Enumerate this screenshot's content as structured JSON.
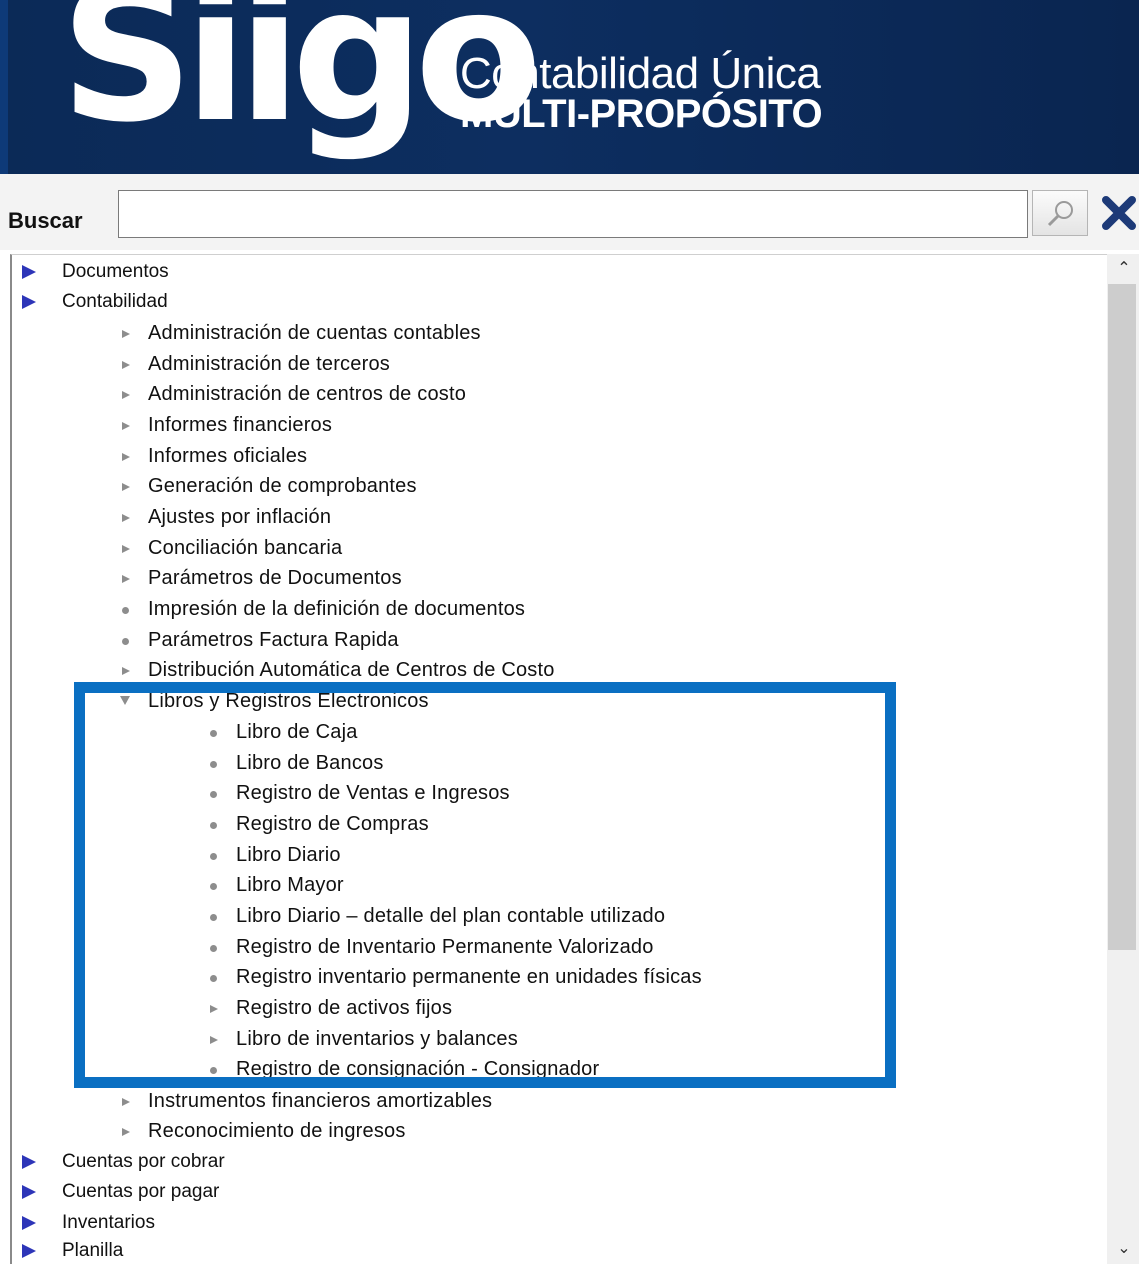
{
  "header": {
    "logo_text": "Siigo",
    "subtitle_line1": "Contabilidad Única",
    "subtitle_line2": "MULTI-PROPÓSITO"
  },
  "search": {
    "label": "Buscar",
    "value": "",
    "placeholder": ""
  },
  "tree": {
    "top_1": "Documentos",
    "top_2": "Contabilidad",
    "sub": [
      "Administración de cuentas contables",
      "Administración de terceros",
      "Administración de centros de costo",
      "Informes financieros",
      "Informes oficiales",
      "Generación de comprobantes",
      "Ajustes por inflación",
      "Conciliación bancaria",
      "Parámetros de Documentos",
      "Impresión de la definición de documentos",
      "Parámetros Factura Rapida",
      "Distribución Automática de Centros de Costo",
      "Libros y Registros Electronicos"
    ],
    "libros": [
      "Libro de Caja",
      "Libro de Bancos",
      "Registro de Ventas e Ingresos",
      "Registro de Compras",
      "Libro Diario",
      "Libro Mayor",
      "Libro Diario – detalle del plan contable utilizado",
      "Registro de Inventario Permanente Valorizado",
      "Registro inventario permanente en unidades físicas",
      "Registro de activos fijos",
      "Libro de inventarios y balances",
      "Registro de consignación - Consignador"
    ],
    "sub_after": [
      "Instrumentos financieros amortizables",
      "Reconocimiento de ingresos"
    ],
    "top_after": [
      "Cuentas por cobrar",
      "Cuentas por pagar",
      "Inventarios",
      "Planilla"
    ]
  },
  "colors": {
    "banner": "#0b2a57",
    "top_arrow": "#2d35b8",
    "highlight": "#0a6fc2"
  },
  "icons": {
    "search": "magnifier-icon",
    "clear": "close-x-icon",
    "expand": "triangle-right-icon",
    "expanded": "triangle-down-icon",
    "leaf": "bullet-icon"
  }
}
